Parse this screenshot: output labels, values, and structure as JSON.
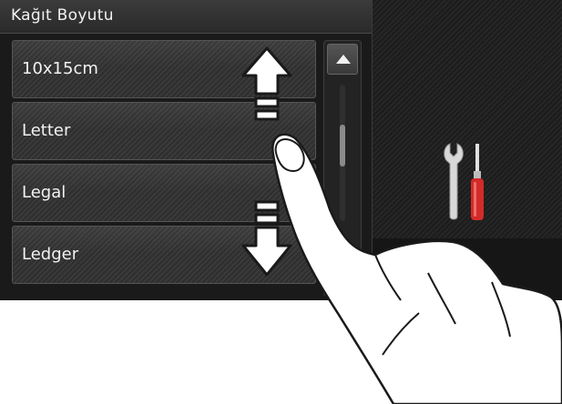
{
  "screen": {
    "title": "Kağıt Boyutu",
    "items": [
      {
        "label": "10x15cm"
      },
      {
        "label": "Letter"
      },
      {
        "label": "Legal"
      },
      {
        "label": "Ledger"
      }
    ]
  },
  "icons": {
    "scroll_up": "triangle-up-icon",
    "settings": "tools-icon",
    "swipe_up": "arrow-up-icon",
    "swipe_down": "arrow-down-icon",
    "hand": "pointing-hand"
  },
  "colors": {
    "screen_bg": "#1e1e1e",
    "item_text": "#f2f2f2",
    "screwdriver": "#d42a2a"
  }
}
